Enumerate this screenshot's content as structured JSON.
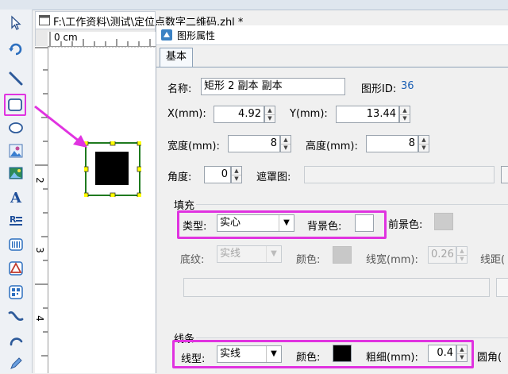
{
  "document": {
    "title": "F:\\工作资料\\测试\\定位点数字二维码.zhl *",
    "ruler_h_label": "0 cm",
    "ruler_v_labels": [
      "2",
      "3",
      "4"
    ]
  },
  "toolbar": {
    "tools": [
      "pointer-icon",
      "rotate-icon",
      "line-icon",
      "rectangle-icon",
      "ellipse-icon",
      "image-icon",
      "picture-icon",
      "text-icon",
      "rich-text-icon",
      "barcode-icon",
      "shape-icon",
      "qrcode-icon",
      "curve-icon",
      "arc-icon",
      "pencil-icon"
    ],
    "selected": "rectangle-icon"
  },
  "dialog": {
    "title": "图形属性",
    "tab": "基本",
    "name_label": "名称:",
    "name_value": "矩形 2 副本 副本",
    "id_label": "图形ID:",
    "id_value": "36",
    "x_label": "X(mm):",
    "x_value": "4.92",
    "y_label": "Y(mm):",
    "y_value": "13.44",
    "width_label": "宽度(mm):",
    "width_value": "8",
    "height_label": "高度(mm):",
    "height_value": "8",
    "angle_label": "角度:",
    "angle_value": "0",
    "mask_label": "遮罩图:",
    "fill": {
      "group_label": "填充",
      "type_label": "类型:",
      "type_value": "实心",
      "bg_label": "背景色:",
      "bg_color": "#ffffff",
      "fg_label": "前景色:",
      "fg_color": "#cccccc",
      "texture_label": "底纹:",
      "texture_value": "实线",
      "color_label": "颜色:",
      "color_value": "#c8c8c8",
      "linewidth_label": "线宽(mm):",
      "linewidth_value": "0.26",
      "spacing_label": "线距("
    },
    "line": {
      "group_label": "线条",
      "type_label": "线型:",
      "type_value": "实线",
      "color_label": "颜色:",
      "color_value": "#000000",
      "thickness_label": "粗细(mm):",
      "thickness_value": "0.4",
      "radius_label": "圆角("
    }
  },
  "colors": {
    "highlight": "#e033e0",
    "id_value_color": "#1a5fb4"
  }
}
